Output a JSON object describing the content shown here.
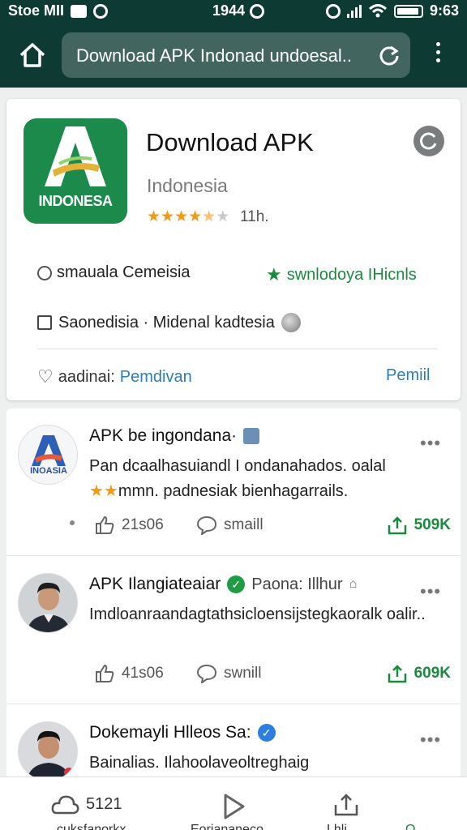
{
  "status_bar": {
    "left_text": "Stoe MII",
    "center_text": "1944",
    "time": "9:63"
  },
  "browser": {
    "url_text": "Download APK Indonad undoesal..",
    "icons": [
      "home-icon",
      "reload-icon",
      "more-vert-icon"
    ]
  },
  "app": {
    "title": "Download APK",
    "subtitle": "Indonesia",
    "rating": 4.5,
    "rating_count": "11h.",
    "logo_text": "INDONESA",
    "info_left": "smauala Cemeisia",
    "info_right": "swnlodoya IHicnls",
    "detail": "Saonedisia · Midenal kadtesia",
    "footer_left_label": "aadinai: ",
    "footer_left_link": "Pemdivan",
    "footer_right": "Pemiil"
  },
  "posts": [
    {
      "title": "APK be ingondana·",
      "avatar_text": "INOASIA",
      "body_line1": "Pan dcaalhasuiandl I ondanahados. oalal",
      "body_stars": "★★",
      "body_line2_rest": "mmn. padnesiak bienhagarrails.",
      "likes": "21s06",
      "comment": "smaill",
      "shares": "509K"
    },
    {
      "title": "APK Ilangiateaiar",
      "meta": "Paona: Illhur",
      "body": "Imdloanraandagtathsicloensijstegkaoralk oalir..",
      "likes": "41s06",
      "comment": "swnill",
      "shares": "609K"
    },
    {
      "title": "Dokemayli Hlleos Sa:",
      "body": "Bainalias. Ilahoolaveoltreghaig"
    }
  ],
  "bottom_nav": {
    "item1_value": "5121",
    "item1_label": "cuksfanorkx",
    "item2_label": "Eoriananeco",
    "item3_label": "Lhli",
    "item4_label": "Q"
  },
  "colors": {
    "header_bg": "#0d3b33",
    "brand_green": "#1b8a4a",
    "accent_blue": "#2d7db8",
    "star_orange": "#f29a13"
  }
}
